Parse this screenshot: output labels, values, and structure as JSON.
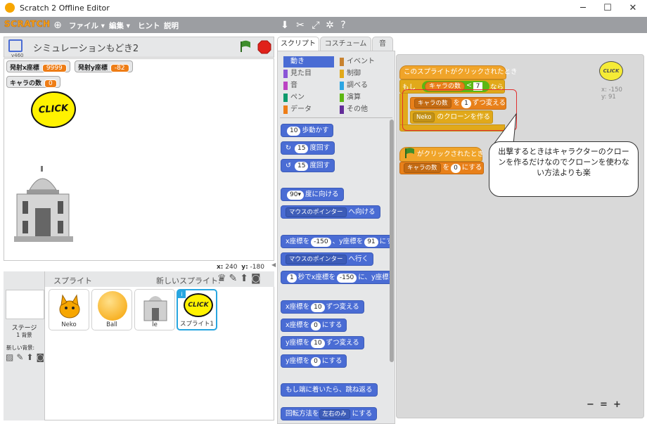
{
  "window": {
    "title": "Scratch 2 Offline Editor",
    "minimize": "─",
    "maximize": "☐",
    "close": "✕"
  },
  "menubar": {
    "logo": "SCRATCH",
    "file": "ファイル ▾",
    "edit": "編集 ▾",
    "tips": "ヒント",
    "about": "説明"
  },
  "toolbar_icons": [
    "stamp-icon",
    "cut-icon",
    "grow-icon",
    "shrink-icon",
    "help-icon"
  ],
  "stage": {
    "version": "v460",
    "project_title": "シミュレーションもどき2",
    "monitors": [
      {
        "label": "発射x座標",
        "value": "9999"
      },
      {
        "label": "発射y座標",
        "value": "-82"
      },
      {
        "label": "キャラの数",
        "value": "0"
      }
    ],
    "sprite_text": "CLICK",
    "coords": {
      "x_label": "x:",
      "x": "240",
      "y_label": "y:",
      "y": "-180"
    }
  },
  "sprites_panel": {
    "title": "スプライト",
    "new_sprite": "新しいスプライト:",
    "stage_label": "ステージ",
    "backdrop_count": "1 背景",
    "new_backdrop": "新しい背景:",
    "sprites": [
      {
        "name": "Neko"
      },
      {
        "name": "Ball"
      },
      {
        "name": "le"
      },
      {
        "name": "スプライト1",
        "thumb_text": "CLICK"
      }
    ]
  },
  "tabs": {
    "scripts": "スクリプト",
    "costumes": "コスチューム",
    "sounds": "音"
  },
  "categories": [
    {
      "label": "動き",
      "color": "#4a6cd4"
    },
    {
      "label": "イベント",
      "color": "#c88330"
    },
    {
      "label": "見た目",
      "color": "#8a55d7"
    },
    {
      "label": "制御",
      "color": "#e1a91a"
    },
    {
      "label": "音",
      "color": "#bb42c3"
    },
    {
      "label": "調べる",
      "color": "#2ca5e2"
    },
    {
      "label": "ペン",
      "color": "#0e9a6c"
    },
    {
      "label": "演算",
      "color": "#5cb712"
    },
    {
      "label": "データ",
      "color": "#ee7d16"
    },
    {
      "label": "その他",
      "color": "#632d99"
    }
  ],
  "palette": {
    "move": {
      "value": "10",
      "text": "歩動かす"
    },
    "turn_right": {
      "value": "15",
      "text": "度回す"
    },
    "turn_left": {
      "value": "15",
      "text": "度回す"
    },
    "point_dir": {
      "value": "90▾",
      "text": "度に向ける"
    },
    "point_towards": {
      "dd": "マウスのポインター",
      "text": "へ向ける"
    },
    "goto_xy": {
      "a": "x座標を",
      "x": "-150",
      "b": "、y座標を",
      "y": "91",
      "c": "にす"
    },
    "goto": {
      "dd": "マウスのポインター",
      "text": "へ行く"
    },
    "glide": {
      "secs": "1",
      "a": "秒でx座標を",
      "x": "-150",
      "b": "に、y座標を"
    },
    "change_x": {
      "a": "x座標を",
      "v": "10",
      "b": "ずつ変える"
    },
    "set_x": {
      "a": "x座標を",
      "v": "0",
      "b": "にする"
    },
    "change_y": {
      "a": "y座標を",
      "v": "10",
      "b": "ずつ変える"
    },
    "set_y": {
      "a": "y座標を",
      "v": "0",
      "b": "にする"
    },
    "bounce": "もし端に着いたら、跳ね返る",
    "rotation": {
      "a": "回転方法を",
      "dd": "左右のみ",
      "b": "にする"
    }
  },
  "script": {
    "hat1": "このスプライトがクリックされたとき",
    "if_label": "もし",
    "if_var": "キャラの数",
    "if_op": "<",
    "if_val": "7",
    "if_then": "なら",
    "change_var": "キャラの数",
    "change_to": "を",
    "change_val": "1",
    "change_end": "ずつ変える",
    "clone_target": "Neko",
    "clone_text": "のクローンを作る",
    "hat2": "がクリックされたとき",
    "set_var": "キャラの数",
    "set_to": "を",
    "set_val": "0",
    "set_end": "にする",
    "sprite_x": "x: -150",
    "sprite_y": "y: 91",
    "sprite_text": "CLICK"
  },
  "callout": "出撃するときはキャラクターのクローンを作るだけなのでクローンを使わない方法よりも楽",
  "zoom": {
    "out": "−",
    "reset": "=",
    "in": "+"
  }
}
